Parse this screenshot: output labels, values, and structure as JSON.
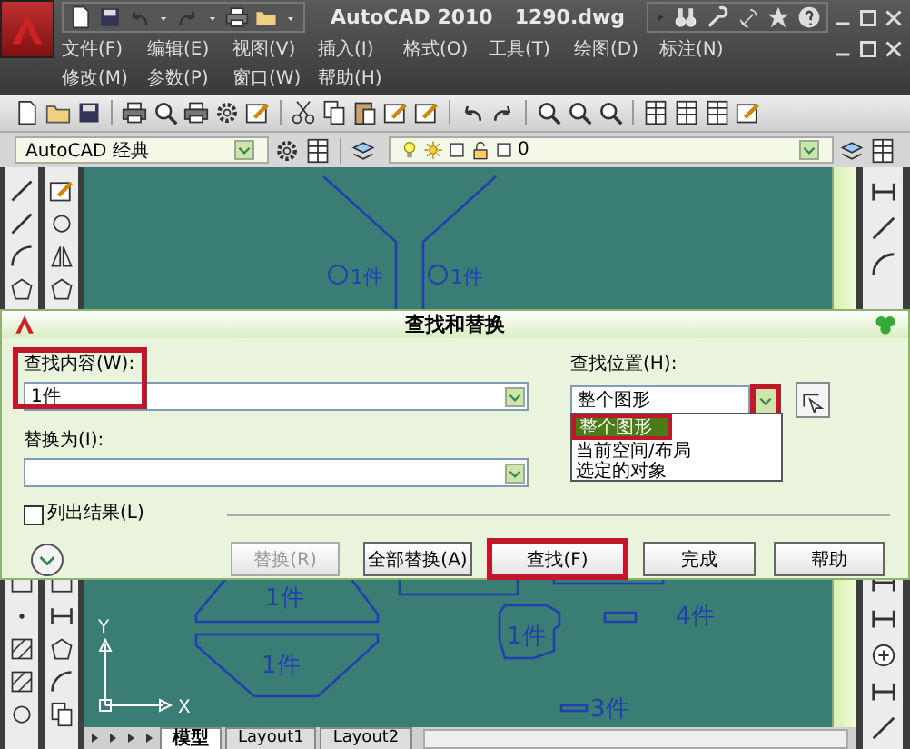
{
  "window": {
    "app_title": "AutoCAD 2010",
    "file_title": "1290.dwg"
  },
  "menu_rows": [
    [
      "文件(F)",
      "编辑(E)",
      "视图(V)",
      "插入(I)",
      "格式(O)",
      "工具(T)",
      "绘图(D)",
      "标注(N)"
    ],
    [
      "修改(M)",
      "参数(P)",
      "窗口(W)",
      "帮助(H)"
    ]
  ],
  "workspace": {
    "value": "AutoCAD 经典"
  },
  "layer": {
    "value": "0"
  },
  "drawing": {
    "labels": [
      "1件",
      "1件",
      "1件",
      "1件",
      "4件",
      "1件",
      "3件"
    ],
    "axis_y": "Y",
    "axis_x": "X"
  },
  "layout_tabs": [
    {
      "label": "模型",
      "selected": true
    },
    {
      "label": "Layout1",
      "selected": false
    },
    {
      "label": "Layout2",
      "selected": false
    }
  ],
  "dialog": {
    "title": "查找和替换",
    "find_label": "查找内容(W):",
    "find_value": "1件",
    "find_highlighted": true,
    "replace_label": "替换为(I):",
    "location_label": "查找位置(H):",
    "location_value": "整个图形",
    "location_arrow_highlighted": true,
    "location_options": [
      {
        "label": "整个图形",
        "selected": true,
        "highlighted": true
      },
      {
        "label": "当前空间/布局",
        "selected": false,
        "highlighted": false
      },
      {
        "label": "选定的对象",
        "selected": false,
        "highlighted": false
      }
    ],
    "list_results": {
      "label": "列出结果(L)",
      "checked": false
    },
    "buttons": [
      {
        "label": "替换(R)",
        "disabled": true,
        "highlighted": false
      },
      {
        "label": "全部替换(A)",
        "disabled": false,
        "highlighted": false
      },
      {
        "label": "查找(F)",
        "disabled": false,
        "highlighted": true
      },
      {
        "label": "完成",
        "disabled": false,
        "highlighted": false
      },
      {
        "label": "帮助",
        "disabled": false,
        "highlighted": false
      }
    ]
  }
}
